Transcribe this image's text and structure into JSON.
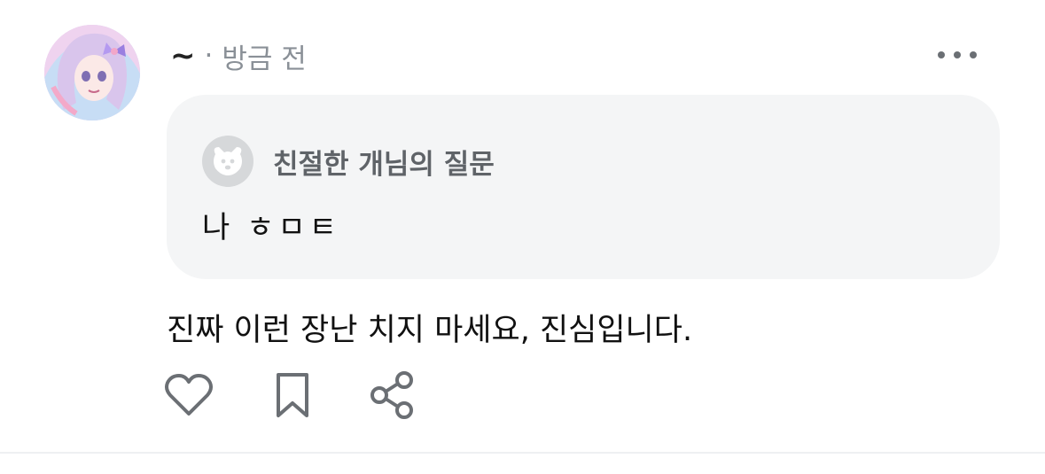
{
  "post": {
    "username": "~",
    "separator": "·",
    "timestamp": "방금 전",
    "more_icon": "more-horizontal-icon",
    "question": {
      "asker": "친절한 개님의 질문",
      "asker_icon": "anonymous-dog-icon",
      "text": "나 ㅎㅁㅌ"
    },
    "answer": "진짜 이런 장난 치지 마세요, 진심입니다.",
    "actions": {
      "like_icon": "heart-icon",
      "save_icon": "bookmark-icon",
      "share_icon": "share-icon"
    }
  },
  "colors": {
    "card_background": "#f4f5f6",
    "icon": "#6b6f74",
    "muted_text": "#8a9097"
  }
}
